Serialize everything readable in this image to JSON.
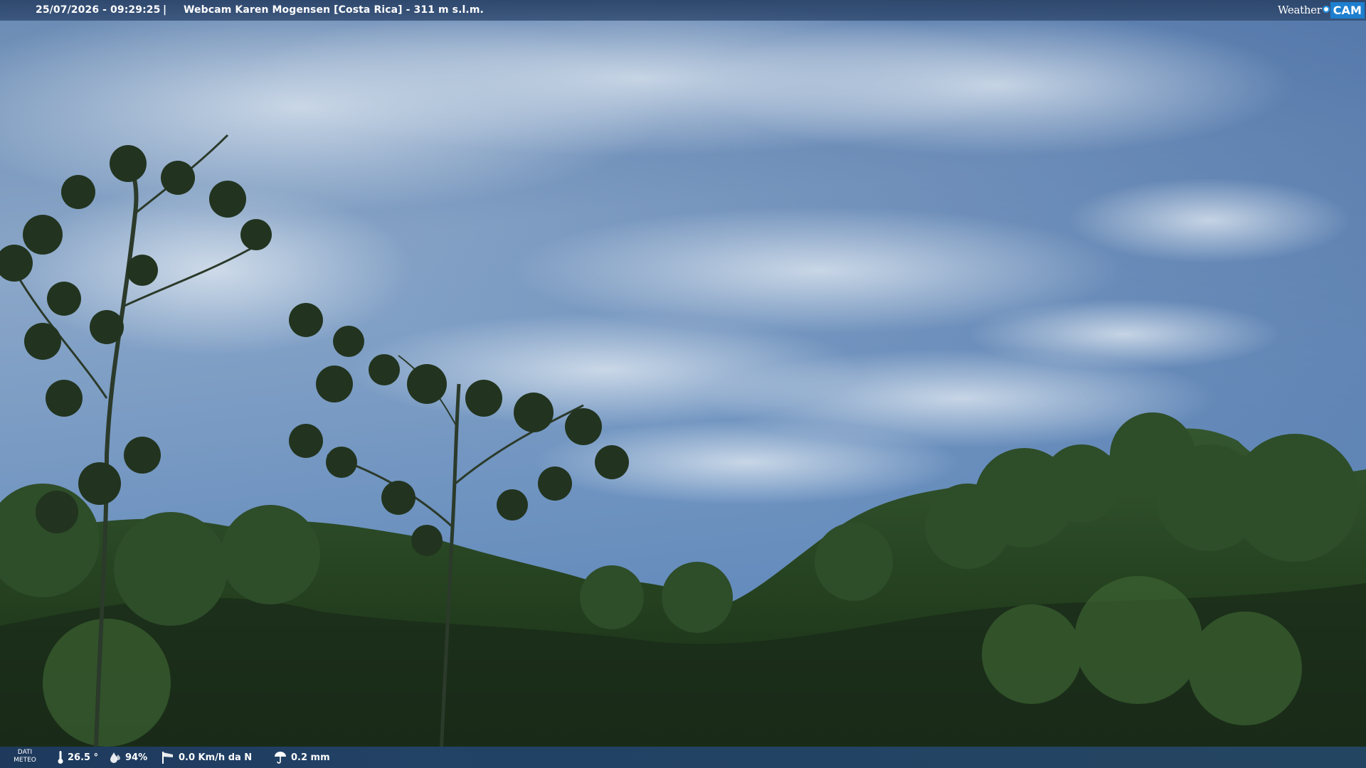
{
  "header": {
    "timestamp": "25/07/2026 - 09:29:25",
    "separator": "|",
    "title": "Webcam Karen Mogensen [Costa Rica]  - 311 m s.l.m."
  },
  "logo": {
    "weather_text": "Weather",
    "cam_text": "CAM",
    "accent": "#1e7fcf"
  },
  "meteo": {
    "label_line1": "DATI",
    "label_line2": "METEO",
    "temperature": "26.5 °",
    "humidity": "94%",
    "wind": "0.0 Km/h da N",
    "rain": "0.2 mm",
    "icons": [
      "thermometer-icon",
      "humidity-drop-icon",
      "wind-sock-icon",
      "rain-umbrella-icon"
    ]
  },
  "colors": {
    "sky_top": "#5f82ab",
    "sky_mid": "#8ea9c9",
    "cloud": "#d4dfea",
    "forest_dark": "#1b2e1c",
    "forest_mid": "#2c4a27",
    "overlay_bar": "#2a4368"
  }
}
